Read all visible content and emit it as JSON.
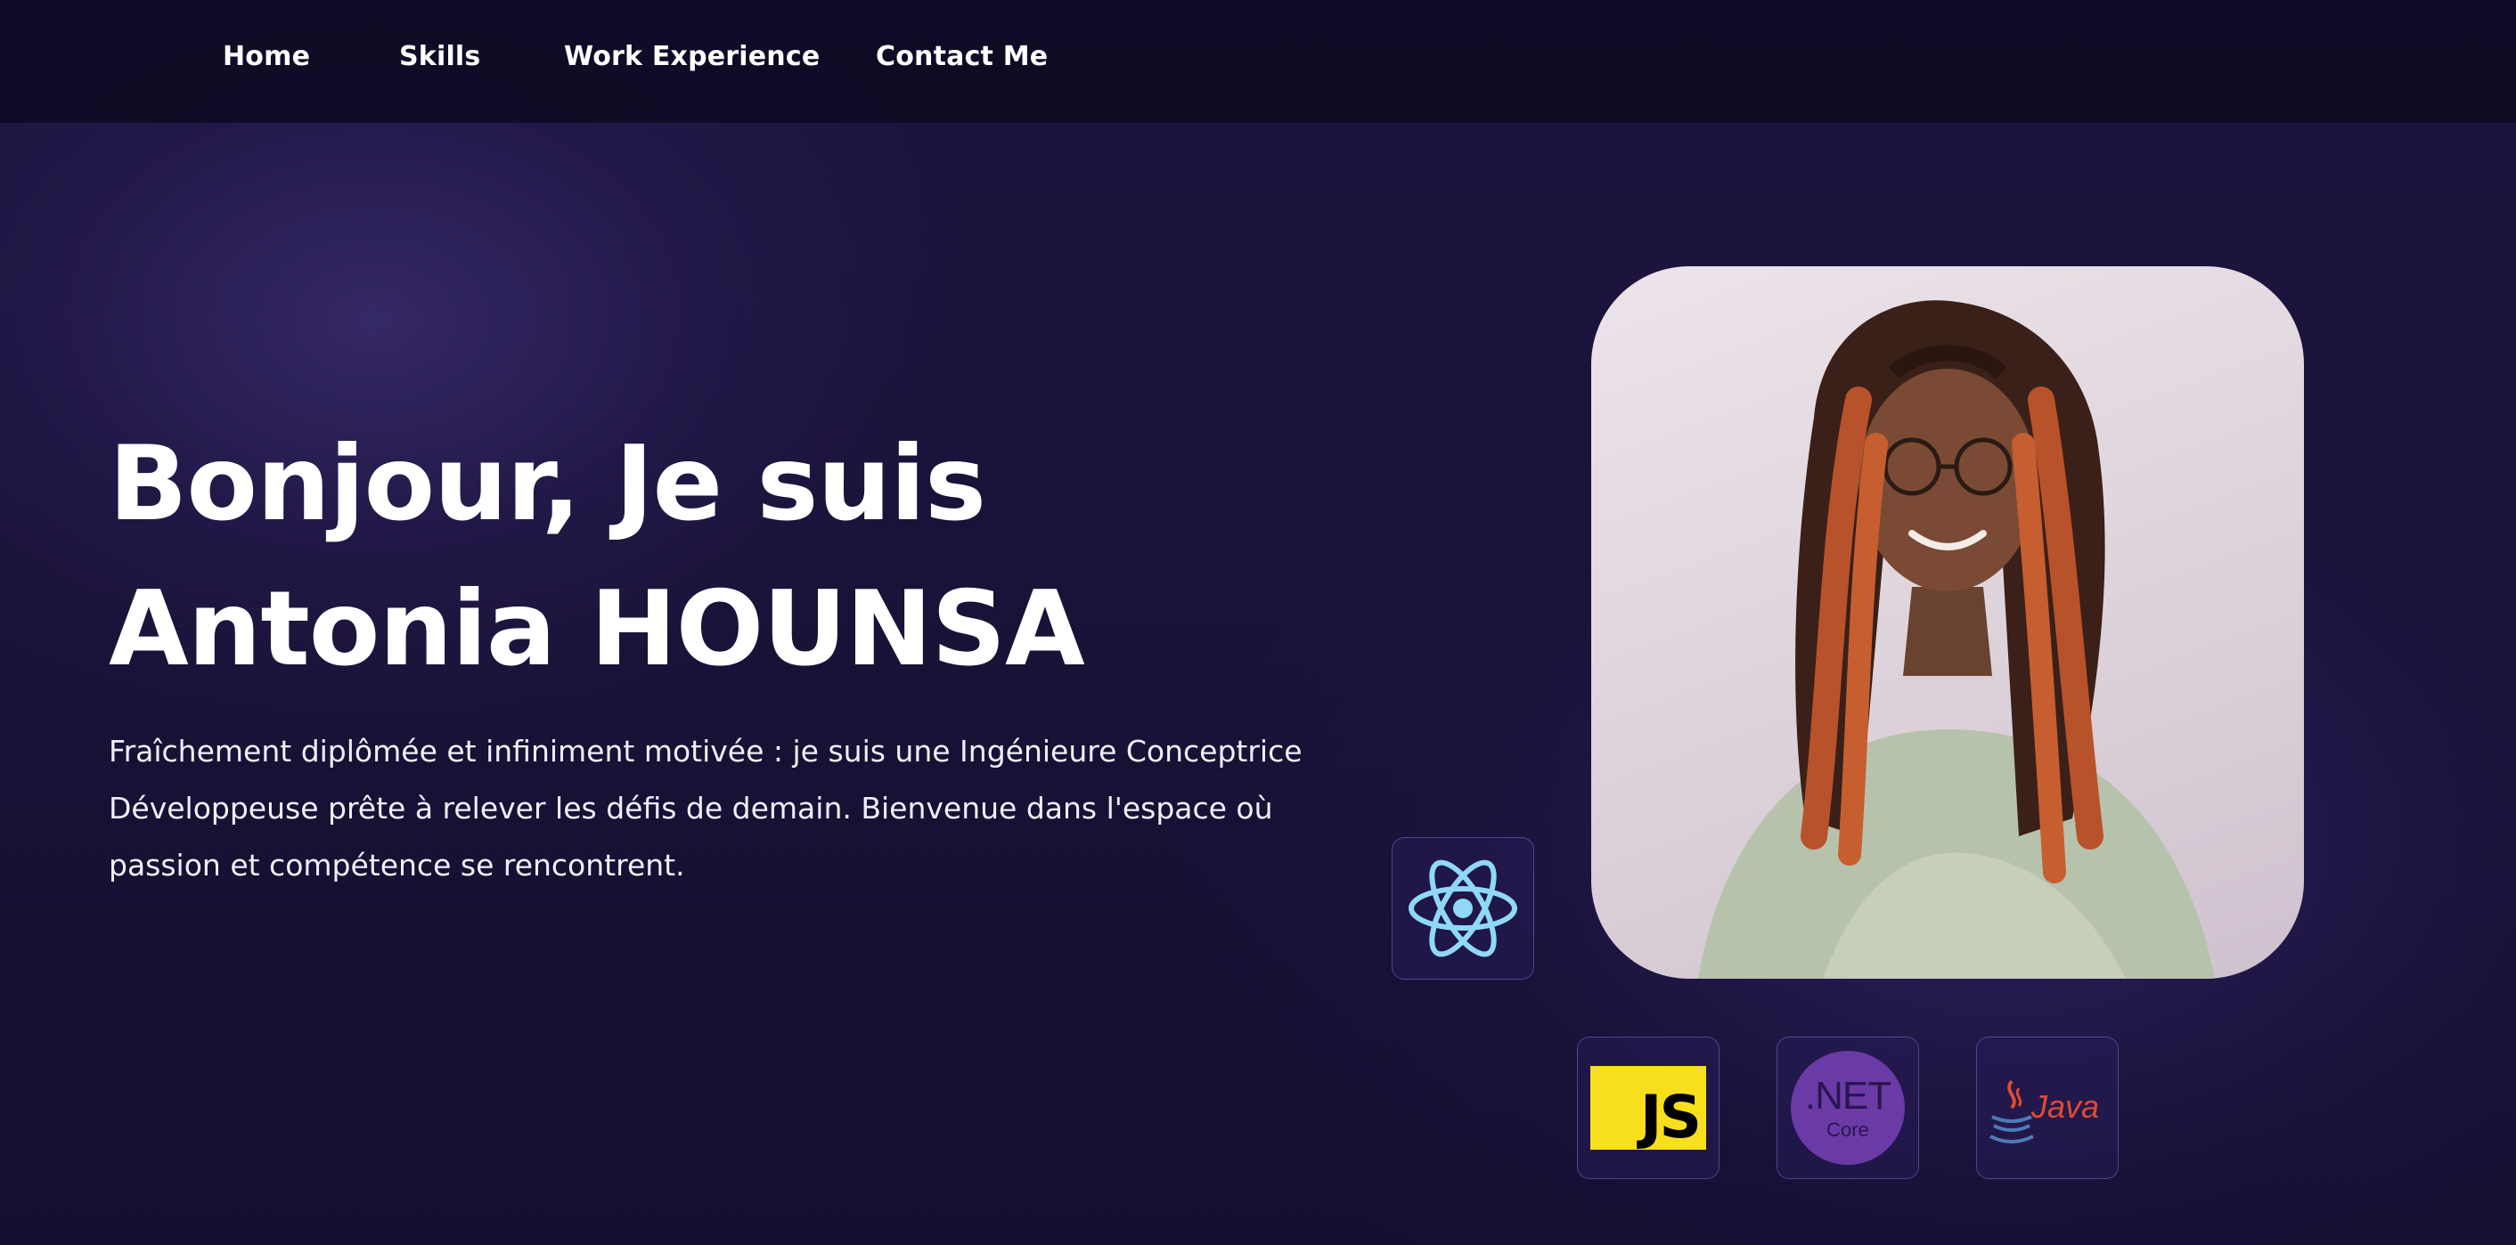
{
  "nav": {
    "items": [
      {
        "label": "Home"
      },
      {
        "label": "Skills"
      },
      {
        "label": "Work Experience"
      },
      {
        "label": "Contact Me"
      }
    ]
  },
  "hero": {
    "headline_line1": "Bonjour, Je suis",
    "headline_line2": "Antonia HOUNSA",
    "intro_line1": "Fraîchement diplômée et infiniment motivée : je suis une Ingénieure Conceptrice",
    "intro_line2": "Développeuse prête à relever les défis de demain. Bienvenue dans l'espace où",
    "intro_line3": "passion et compétence se rencontrent."
  },
  "tech_logos": {
    "react": {
      "icon": "react-icon",
      "color": "#61dafb"
    },
    "javascript": {
      "icon": "javascript-icon",
      "text": "JS",
      "color": "#f7df1e"
    },
    "dotnet": {
      "icon": "dotnet-core-icon",
      "text_main": ".NET",
      "text_sub": "Core",
      "color": "#6a3aa6"
    },
    "java": {
      "icon": "java-icon",
      "text": "Java",
      "color": "#e04a32"
    }
  },
  "colors": {
    "background": "#1a1238",
    "navbar": "#0e0a22",
    "text": "#ffffff"
  }
}
